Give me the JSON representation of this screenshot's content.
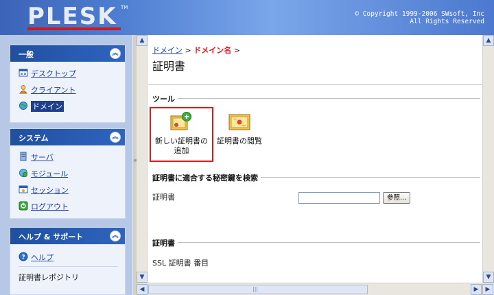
{
  "header": {
    "logo": "PLESK",
    "logo_tm": "TM",
    "copyright_line1": "© Copyright 1999-2006 SWsoft, Inc",
    "copyright_line2": "All Rights Reserved"
  },
  "sidebar": {
    "general": {
      "title": "一般",
      "items": [
        {
          "label": "デスクトップ",
          "icon": "desktop-icon"
        },
        {
          "label": "クライアント",
          "icon": "client-icon"
        },
        {
          "label": "ドメイン",
          "icon": "domain-icon",
          "selected": true
        }
      ]
    },
    "system": {
      "title": "システム",
      "items": [
        {
          "label": "サーバ",
          "icon": "server-icon"
        },
        {
          "label": "モジュール",
          "icon": "modules-icon"
        },
        {
          "label": "セッション",
          "icon": "sessions-icon"
        },
        {
          "label": "ログアウト",
          "icon": "logout-icon"
        }
      ]
    },
    "help": {
      "title": "ヘルプ & サポート",
      "items": [
        {
          "label": "ヘルプ",
          "icon": "help-icon"
        }
      ],
      "static": "証明書レポジトリ"
    }
  },
  "main": {
    "breadcrumb": {
      "link": "ドメイン",
      "sep1": " > ",
      "current": "ドメイン名",
      "sep2": " >"
    },
    "title": "証明書",
    "tools_section": "ツール",
    "tools": [
      {
        "line1": "新しい証明書の",
        "line2": "追加",
        "icon": "add-certificate-icon"
      },
      {
        "line1": "証明書の閲覧",
        "line2": "",
        "icon": "view-certificate-icon"
      }
    ],
    "search_section": "証明書に適合する秘密鍵を検索",
    "field_label": "証明書",
    "file_value": "",
    "browse_label": "参照...",
    "cert_section": "証明書",
    "cert_row": "SSL 証明書 番目"
  },
  "colors": {
    "header_blue": "#4f7fd2",
    "panel_head": "#1f4fa0",
    "sidebar_bg": "#b6c8e6",
    "crumb_current": "#e0121a",
    "highlight": "#e01818"
  }
}
